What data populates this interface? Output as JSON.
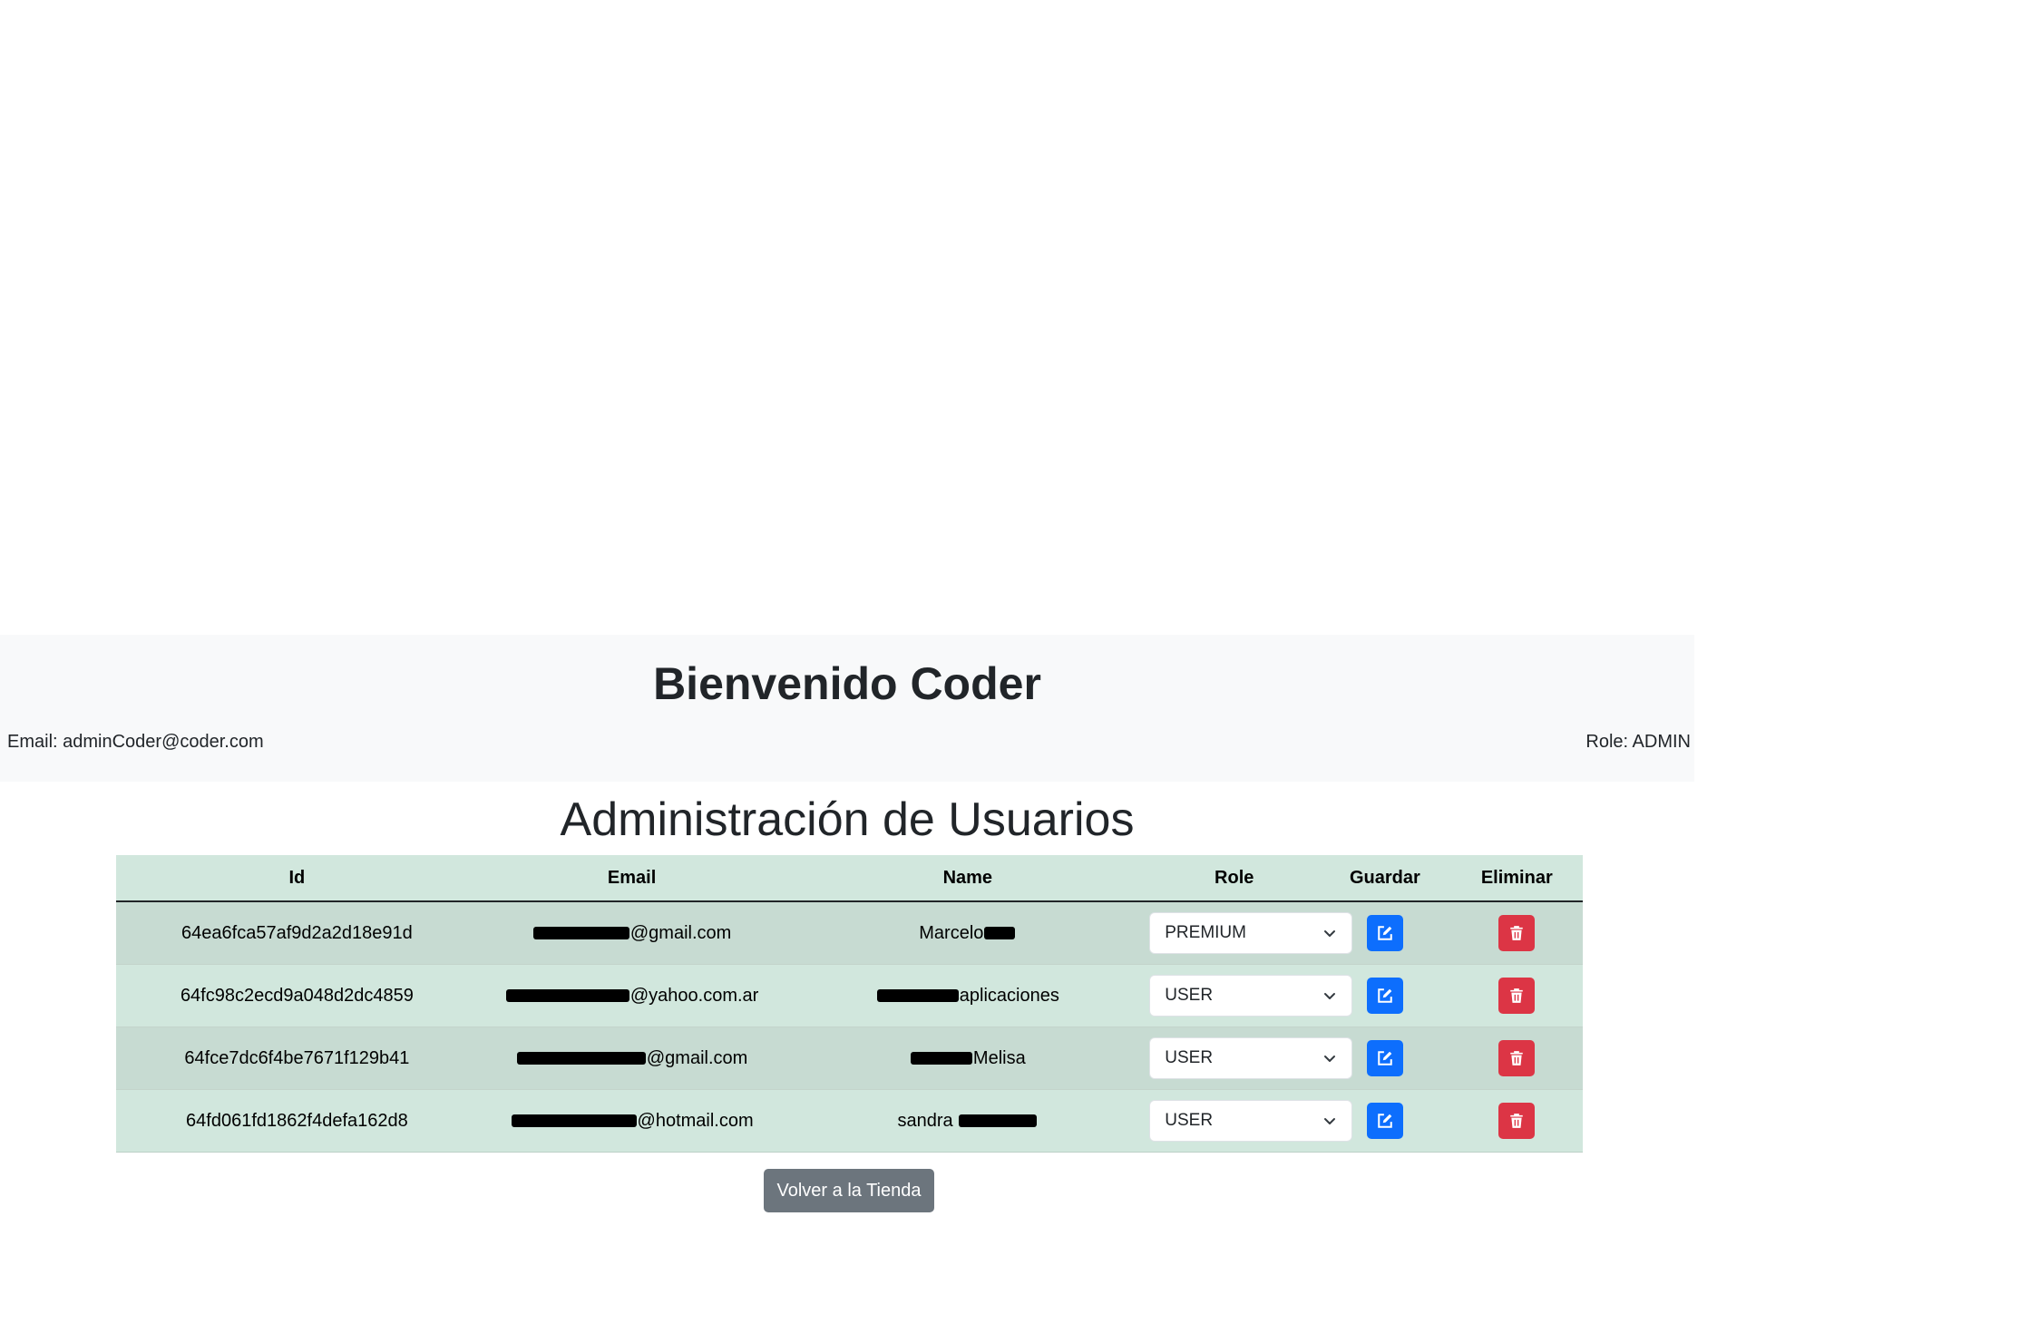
{
  "header": {
    "title": "Bienvenido Coder",
    "email_text": "Email: adminCoder@coder.com",
    "role_text": "Role: ADMIN"
  },
  "main": {
    "title": "Administración de Usuarios"
  },
  "table": {
    "columns": [
      "Id",
      "Email",
      "Name",
      "Role",
      "Guardar",
      "Eliminar"
    ],
    "rows": [
      {
        "id": "64ea6fca57af9d2a2d18e91d",
        "email_visible": "@gmail.com",
        "name_visible": "Marcelo",
        "role": "PREMIUM"
      },
      {
        "id": "64fc98c2ecd9a048d2dc4859",
        "email_visible": "@yahoo.com.ar",
        "name_visible": "aplicaciones",
        "role": "USER"
      },
      {
        "id": "64fce7dc6f4be7671f129b41",
        "email_visible": "@gmail.com",
        "name_visible": "Melisa",
        "role": "USER"
      },
      {
        "id": "64fd061fd1862f4defa162d8",
        "email_visible": "@hotmail.com",
        "name_visible": "sandra",
        "role": "USER"
      }
    ]
  },
  "footer": {
    "back_label": "Volver a la Tienda"
  },
  "colors": {
    "header_bg": "#f8f9fa",
    "table_header_bg": "#d1e7dd",
    "edit_button": "#0d6efd",
    "delete_button": "#dc3545",
    "back_button": "#6c757d"
  },
  "icons": {
    "edit": "pencil-square-icon",
    "delete": "trash-icon",
    "select": "chevron-down-icon"
  }
}
